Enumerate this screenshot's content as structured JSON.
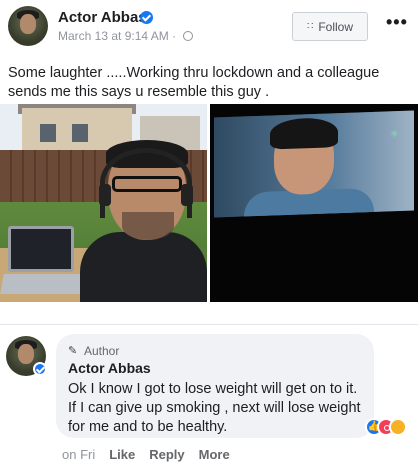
{
  "post": {
    "author": "Actor Abbas",
    "timestamp": "March 13 at 9:14 AM",
    "separator": "·",
    "follow_label": "Follow",
    "more_label": "•••",
    "text": "Some laughter .....Working thru lockdown and a colleague sends me this says u resemble this guy ."
  },
  "comment": {
    "badge": "Author",
    "author": "Actor Abbas",
    "text": "Ok I know I got to lose weight will get on to it. If I can give up smoking , next will lose weight for me and to be healthy.",
    "time": "on Fri",
    "like_label": "Like",
    "reply_label": "Reply",
    "more_label": "More"
  },
  "icons": {
    "verified": "verified-check-icon",
    "globe": "globe-icon",
    "follow": "rss-icon",
    "pen": "pen-icon",
    "reactions": [
      "like-reaction-icon",
      "wow-reaction-icon",
      "care-reaction-icon"
    ]
  },
  "colors": {
    "brand_blue": "#1877f2",
    "text": "#1c1e21",
    "muted": "#65676b",
    "bubble": "#f0f2f5"
  }
}
